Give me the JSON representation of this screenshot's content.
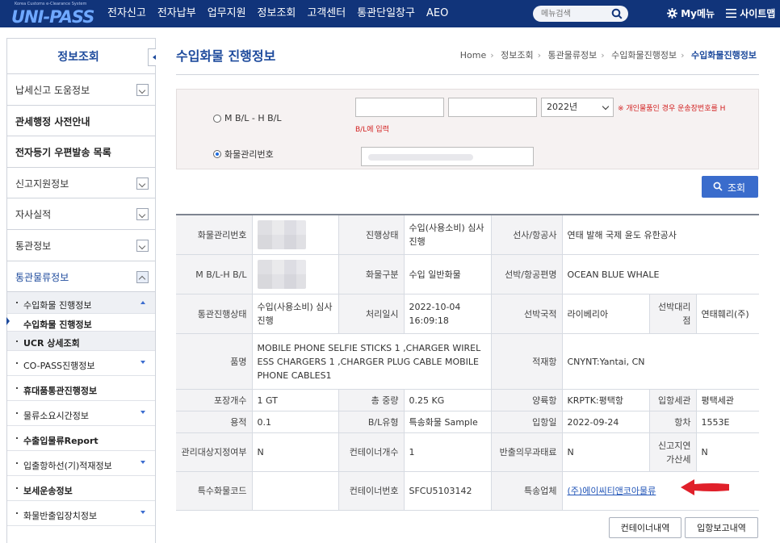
{
  "header": {
    "logo_text": "UNI-PASS",
    "logo_sub": "Korea Customs e-Clearance System",
    "nav": [
      "전자신고",
      "전자납부",
      "업무지원",
      "정보조회",
      "고객센터",
      "통관단일창구",
      "AEO"
    ],
    "search_placeholder": "메뉴검색",
    "my_menu": "My메뉴",
    "sitemap": "사이트맵"
  },
  "sidebar": {
    "title": "정보조회",
    "items": [
      {
        "label": "납세신고 도움정보",
        "expandable": true
      },
      {
        "label": "관세행정 사전안내",
        "bold": true
      },
      {
        "label": "전자등기 우편발송 목록",
        "bold": true
      },
      {
        "label": "신고지원정보",
        "expandable": true
      },
      {
        "label": "자사실적",
        "expandable": true
      },
      {
        "label": "통관정보",
        "expandable": true
      },
      {
        "label": "통관물류정보",
        "expandable": true,
        "open": true
      }
    ],
    "sub_items": [
      {
        "label": "수입화물 진행정보"
      },
      {
        "label": "수입화물 진행정보"
      },
      {
        "label": "UCR 상세조회"
      },
      {
        "label": "CO-PASS진행정보"
      },
      {
        "label": "휴대품통관진행정보"
      },
      {
        "label": "물류소요시간정보"
      },
      {
        "label": "수출입물류Report"
      },
      {
        "label": "입출항하선(기)적재정보"
      },
      {
        "label": "보세운송정보"
      },
      {
        "label": "화물반출입장치정보"
      }
    ]
  },
  "page": {
    "title": "수입화물 진행정보",
    "breadcrumb": [
      "Home",
      "정보조회",
      "통관물류정보",
      "수입화물진행정보",
      "수입화물진행정보"
    ]
  },
  "search": {
    "radio_bl": "M B/L - H B/L",
    "radio_cargo": "화물관리번호",
    "year": "2022년",
    "notice_1": "※ 개인물품인 경우 운송장번호를 H",
    "notice_2": "B/L에 입력",
    "button": "조회"
  },
  "table": {
    "rows": [
      {
        "h1": "화물관리번호",
        "h2": "진행상태",
        "v2": "수입(사용소비) 심사진행",
        "h3": "선사/항공사",
        "v3": "연태 발해 국제 윤도 유한공사"
      },
      {
        "h1": "M B/L-H B/L",
        "h2": "화물구분",
        "v2": "수입 일반화물",
        "h3": "선박/항공편명",
        "v3": "OCEAN BLUE WHALE"
      },
      {
        "h1": "통관진행상태",
        "v1": "수입(사용소비) 심사진행",
        "h2": "처리일시",
        "v2": "2022-10-04 16:09:18",
        "h3": "선박국적",
        "v3": "라이베리아",
        "h4": "선박대리점",
        "v4": "연태훼리(주)"
      },
      {
        "h1": "품명",
        "v1": "MOBILE PHONE SELFIE STICKS 1 ,CHARGER WIRELESS CHARGERS 1 ,CHARGER PLUG CABLE MOBILE PHONE CABLES1",
        "h3": "적재항",
        "v3": "CNYNT:Yantai, CN"
      },
      {
        "h1": "포장개수",
        "v1": "1 GT",
        "h2": "총 중량",
        "v2": "0.25 KG",
        "h3": "양륙항",
        "v3": "KRPTK:평택항",
        "h4": "입항세관",
        "v4": "평택세관"
      },
      {
        "h1": "용적",
        "v1": "0.1",
        "h2": "B/L유형",
        "v2": "특송화물 Sample",
        "h3": "입항일",
        "v3": "2022-09-24",
        "h4": "항차",
        "v4": "1553E"
      },
      {
        "h1": "관리대상지정여부",
        "v1": "N",
        "h2": "컨테이너개수",
        "v2": "1",
        "h3": "반출의무과태료",
        "v3": "N",
        "h4": "신고지연가산세",
        "v4": "N"
      },
      {
        "h1": "특수화물코드",
        "v1": "",
        "h2": "컨테이너번호",
        "v2": "SFCU5103142",
        "h3": "특송업체",
        "v3": "(주)에이씨티앤코아물류"
      }
    ]
  },
  "buttons": {
    "container": "컨테이너내역",
    "arrival": "입항보고내역"
  },
  "colors": {
    "header_bg": "#11347a",
    "accent": "#1d4a9c",
    "notice": "#d21f1f",
    "arrow": "#e0202a"
  }
}
